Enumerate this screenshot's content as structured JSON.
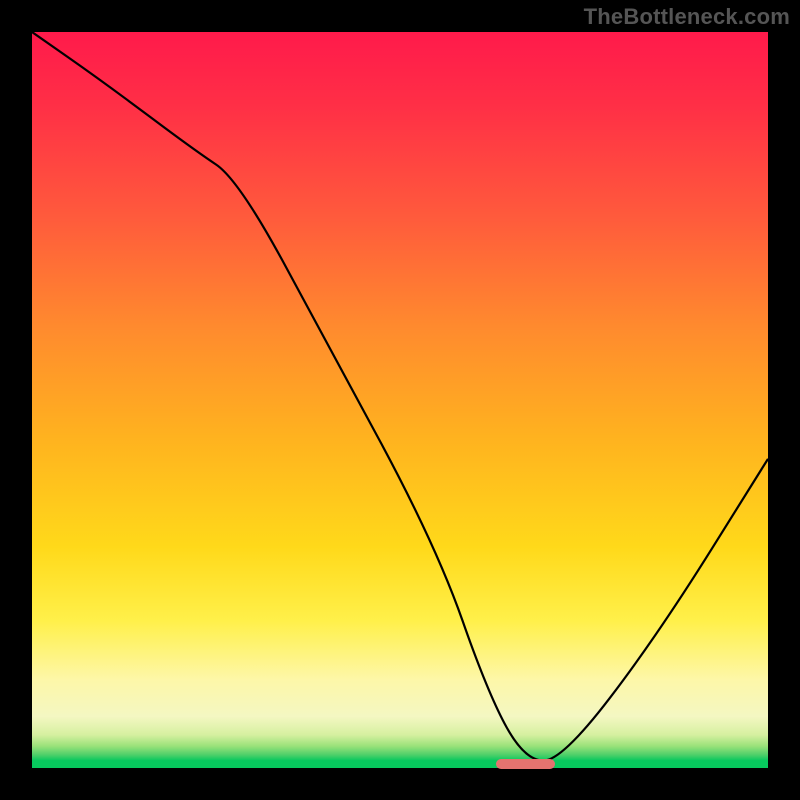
{
  "watermark": "TheBottleneck.com",
  "colors": {
    "frame": "#000000",
    "curve": "#000000",
    "marker": "#e4736f",
    "gradient_stops": [
      "#ff1a4b",
      "#ff2f46",
      "#ff5a3c",
      "#ff8a2e",
      "#ffb21f",
      "#ffd91a",
      "#fff04a",
      "#fdf7a8",
      "#f4f7c2",
      "#d6f0a0",
      "#9be27a",
      "#4fd06a",
      "#07c85d"
    ]
  },
  "chart_data": {
    "type": "line",
    "title": "",
    "xlabel": "",
    "ylabel": "",
    "xlim": [
      0,
      100
    ],
    "ylim": [
      0,
      100
    ],
    "grid": false,
    "legend": false,
    "series": [
      {
        "name": "bottleneck-curve",
        "x": [
          0,
          10,
          22,
          28,
          40,
          55,
          62,
          67,
          72,
          85,
          100
        ],
        "y": [
          100,
          93,
          84,
          80,
          58,
          30,
          10,
          1,
          1,
          18,
          42
        ]
      }
    ],
    "marker": {
      "name": "optimal-range",
      "x_start": 63,
      "x_end": 71,
      "y": 0.5
    },
    "notes": "x and y are in percent of the plot area; (0,0) is bottom-left. Values are visually estimated from the raster — the chart has no axis ticks or numeric labels."
  }
}
